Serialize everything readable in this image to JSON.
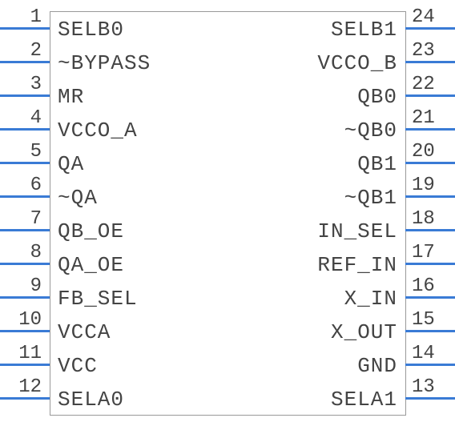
{
  "chip": {
    "left_pins": [
      {
        "num": "1",
        "label": "SELB0"
      },
      {
        "num": "2",
        "label": "~BYPASS"
      },
      {
        "num": "3",
        "label": "MR"
      },
      {
        "num": "4",
        "label": "VCCO_A"
      },
      {
        "num": "5",
        "label": "QA"
      },
      {
        "num": "6",
        "label": "~QA"
      },
      {
        "num": "7",
        "label": "QB_OE"
      },
      {
        "num": "8",
        "label": "QA_OE"
      },
      {
        "num": "9",
        "label": "FB_SEL"
      },
      {
        "num": "10",
        "label": "VCCA"
      },
      {
        "num": "11",
        "label": "VCC"
      },
      {
        "num": "12",
        "label": "SELA0"
      }
    ],
    "right_pins": [
      {
        "num": "24",
        "label": "SELB1"
      },
      {
        "num": "23",
        "label": "VCCO_B"
      },
      {
        "num": "22",
        "label": "QB0"
      },
      {
        "num": "21",
        "label": "~QB0"
      },
      {
        "num": "20",
        "label": "QB1"
      },
      {
        "num": "19",
        "label": "~QB1"
      },
      {
        "num": "18",
        "label": "IN_SEL"
      },
      {
        "num": "17",
        "label": "REF_IN"
      },
      {
        "num": "16",
        "label": "X_IN"
      },
      {
        "num": "15",
        "label": "X_OUT"
      },
      {
        "num": "14",
        "label": "GND"
      },
      {
        "num": "13",
        "label": "SELA1"
      }
    ]
  }
}
